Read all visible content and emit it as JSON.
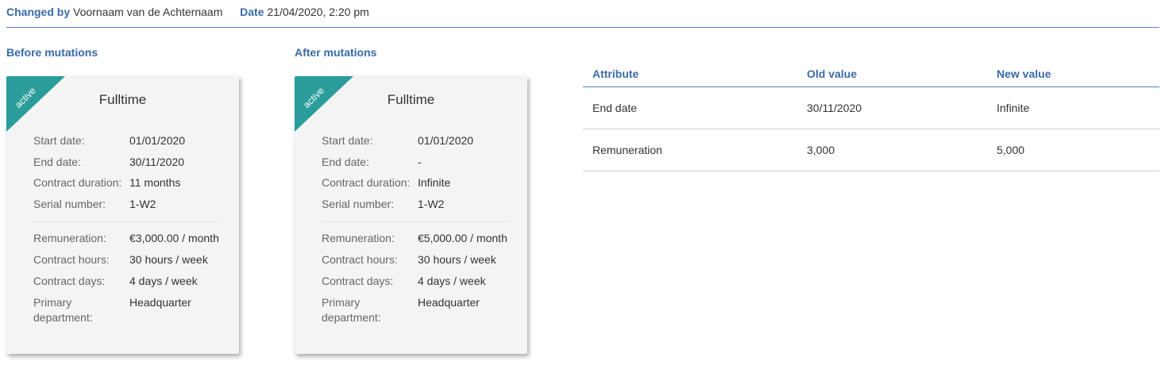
{
  "header": {
    "changed_by_label": "Changed by",
    "changed_by_value": "Voornaam van de Achternaam",
    "date_label": "Date",
    "date_value": "21/04/2020, 2:20 pm"
  },
  "before": {
    "section_title": "Before mutations",
    "badge": "active",
    "title": "Fulltime",
    "fields": [
      {
        "label": "Start date:",
        "value": "01/01/2020"
      },
      {
        "label": "End date:",
        "value": "30/11/2020"
      },
      {
        "label": "Contract duration:",
        "value": "11 months"
      },
      {
        "label": "Serial number:",
        "value": "1-W2"
      },
      {
        "label": "Remuneration:",
        "value": "€3,000.00 / month"
      },
      {
        "label": "Contract hours:",
        "value": "30 hours / week"
      },
      {
        "label": "Contract days:",
        "value": "4 days / week"
      },
      {
        "label": "Primary department:",
        "value": "Headquarter"
      }
    ]
  },
  "after": {
    "section_title": "After mutations",
    "badge": "active",
    "title": "Fulltime",
    "fields": [
      {
        "label": "Start date:",
        "value": "01/01/2020"
      },
      {
        "label": "End date:",
        "value": "-"
      },
      {
        "label": "Contract duration:",
        "value": "Infinite"
      },
      {
        "label": "Serial number:",
        "value": "1-W2"
      },
      {
        "label": "Remuneration:",
        "value": "€5,000.00 / month"
      },
      {
        "label": "Contract hours:",
        "value": "30 hours / week"
      },
      {
        "label": "Contract days:",
        "value": "4 days / week"
      },
      {
        "label": "Primary department:",
        "value": "Headquarter"
      }
    ]
  },
  "changes": {
    "columns": [
      "Attribute",
      "Old value",
      "New value"
    ],
    "rows": [
      [
        "End date",
        "30/11/2020",
        "Infinite"
      ],
      [
        "Remuneration",
        "3,000",
        "5,000"
      ]
    ]
  },
  "colors": {
    "accent": "#3a6aa8",
    "badge": "#2a9d9a",
    "card_bg": "#f4f4f4"
  }
}
